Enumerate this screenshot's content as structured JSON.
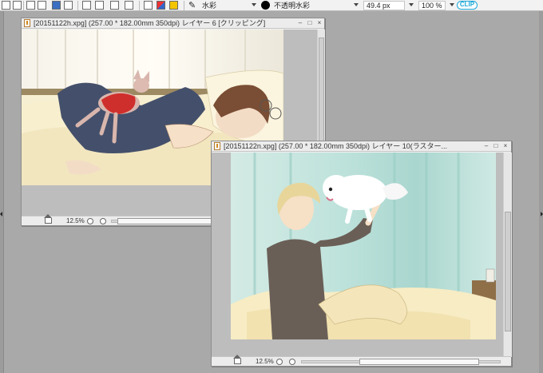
{
  "toolbar": {
    "brush_name": "水彩",
    "subtool_name": "不透明水彩",
    "brush_size": "49.4 px",
    "opacity": "100 %",
    "logo_text": "CLIP",
    "icons": [
      "layer-property-icon",
      "info-icon",
      "select-lasso-icon",
      "transform-icon",
      "grid-icon",
      "fill-icon",
      "rule-icon",
      "camera-icon",
      "pen-icon",
      "color-set-icon",
      "swap-color-icon",
      "bucket-icon"
    ],
    "colors": {
      "main": "#000000",
      "logo": "#1ba7d8"
    }
  },
  "window1": {
    "title": "[20151122h.xpg] (257.00 * 182.00mm 350dpi)   レイヤー 6 [クリッピング]",
    "zoom": "12.5%",
    "buttons": {
      "minimize": "–",
      "maximize": "□",
      "close": "×"
    }
  },
  "window2": {
    "title": "[20151122n.xpg] (257.00 * 182.00mm 350dpi)   レイヤー 10(ラスター...",
    "zoom": "12.5%",
    "buttons": {
      "minimize": "–",
      "maximize": "□",
      "close": "×"
    }
  }
}
